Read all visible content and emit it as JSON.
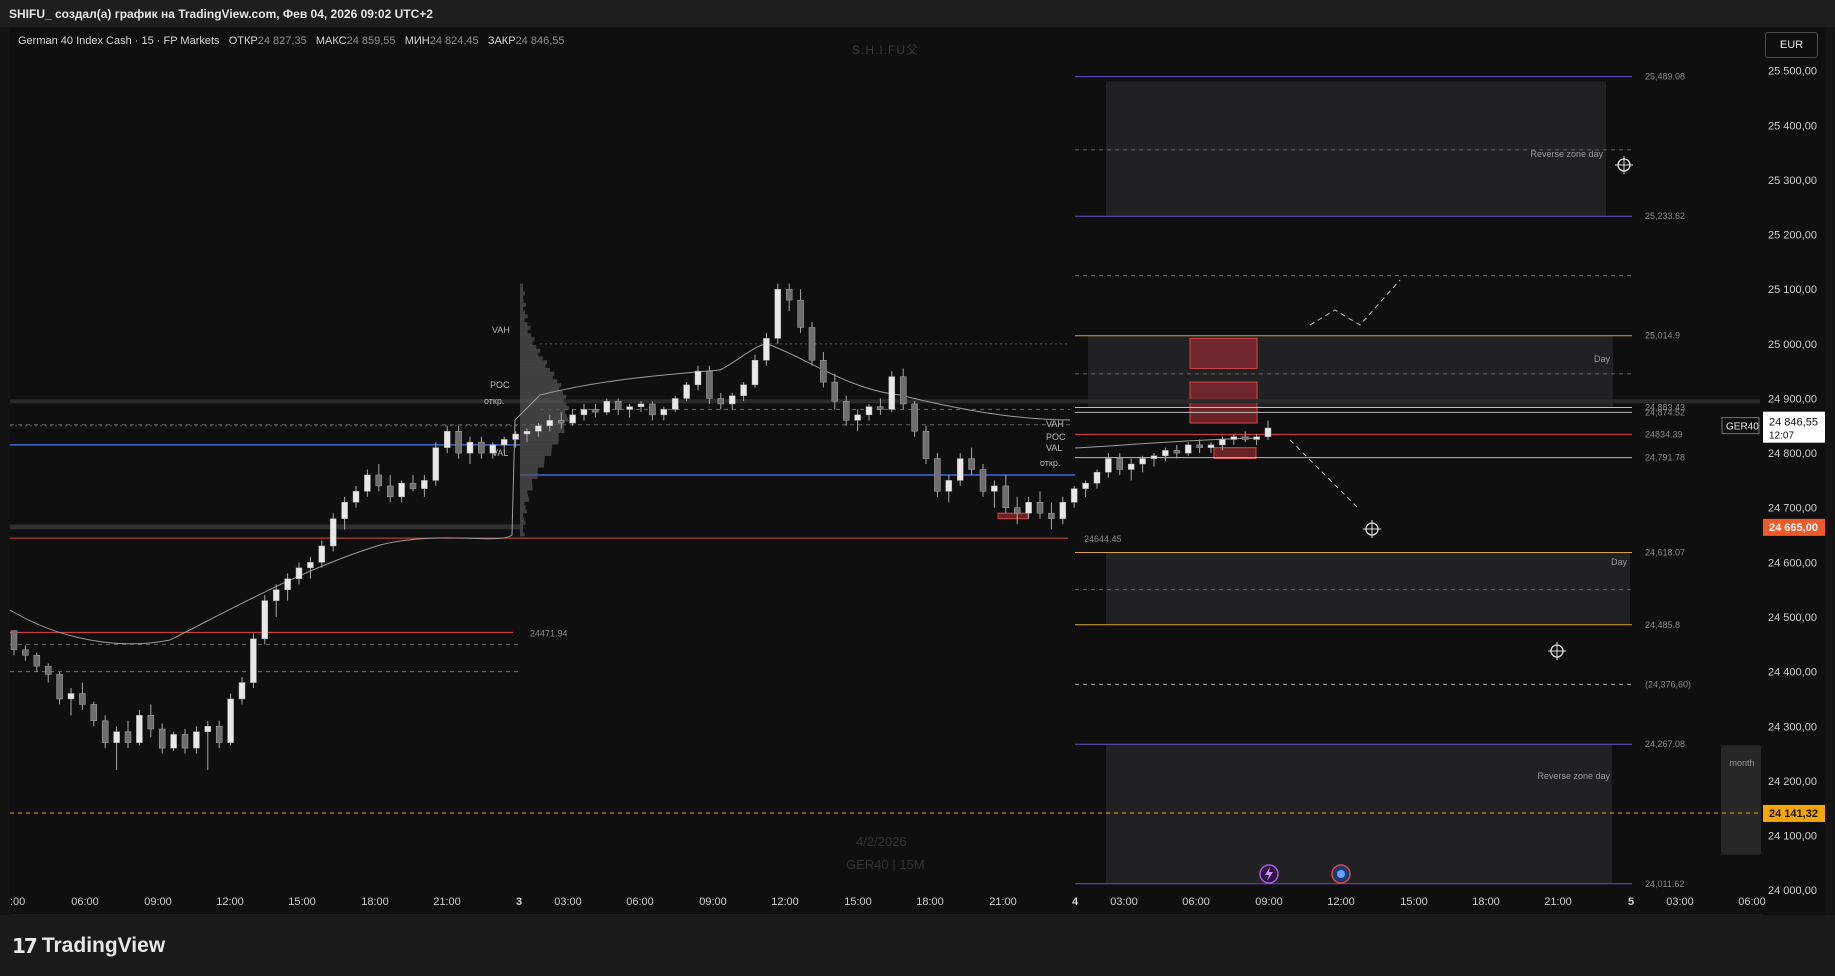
{
  "window": {
    "title": "SHIFU_ создал(а) график на TradingView.com, Фев 04, 2026 09:02 UTC+2"
  },
  "legend": {
    "symbol": "German 40 Index Cash · 15 · FP Markets",
    "open_label": "ОТКР",
    "open_value": "24 827,35",
    "high_label": "МАКС",
    "high_value": "24 859,55",
    "low_label": "МИН",
    "low_value": "24 824,45",
    "close_label": "ЗАКР",
    "close_value": "24 846,55"
  },
  "watermark": "S.H.I.FU父",
  "background_date": "4/2/2026",
  "background_symbol": "GER40 | 15M",
  "currency": "EUR",
  "brand": {
    "name": "TradingView"
  },
  "chart_data": {
    "type": "candlestick",
    "symbol": "GER40",
    "timeframe": "15",
    "y_axis": {
      "side": "right",
      "ylim": [
        23960,
        25580
      ],
      "ticks": [
        "25 500,00",
        "25 400,00",
        "25 300,00",
        "25 200,00",
        "25 100,00",
        "25 000,00",
        "24 900,00",
        "24 800,00",
        "24 700,00",
        "24 600,00",
        "24 500,00",
        "24 400,00",
        "24 300,00",
        "24 200,00",
        "24 100,00",
        "24 000,00"
      ],
      "tick_values": [
        25500,
        25400,
        25300,
        25200,
        25100,
        25000,
        24900,
        24800,
        24700,
        24600,
        24500,
        24400,
        24300,
        24200,
        24100,
        24000
      ]
    },
    "x_axis": {
      "ticks": [
        ":00",
        "06:00",
        "09:00",
        "12:00",
        "15:00",
        "18:00",
        "21:00",
        "3",
        "03:00",
        "06:00",
        "09:00",
        "12:00",
        "15:00",
        "18:00",
        "21:00",
        "4",
        "03:00",
        "06:00",
        "09:00",
        "12:00",
        "15:00",
        "18:00",
        "21:00",
        "5",
        "03:00",
        "06:00"
      ]
    },
    "price_labels": [
      {
        "symbol": "GER40",
        "price": "24 846,55",
        "countdown": "12:07",
        "value": 24846.55,
        "color": "#ffffff"
      },
      {
        "price": "24 665,00",
        "value": 24665,
        "color": "#f05a28"
      },
      {
        "price": "24 141,32",
        "value": 24141.32,
        "color": "#f7a600"
      }
    ],
    "levels": [
      {
        "label": "25,489.08",
        "value": 25489.08,
        "color": "#6a4fd0"
      },
      {
        "label": "25,233.62",
        "value": 25233.62,
        "color": "#6a4fd0"
      },
      {
        "label": "25,014.9",
        "value": 25014.9,
        "color": "#d9a43a"
      },
      {
        "label": "24,883.43",
        "value": 24883.43,
        "color": "#bdbdbd"
      },
      {
        "label": "24,874.52",
        "value": 24874.52,
        "color": "#bdbdbd"
      },
      {
        "label": "24834.39",
        "value": 24834.39,
        "color": "#e04545"
      },
      {
        "label": "24,791.78",
        "value": 24791.78,
        "color": "#bdbdbd"
      },
      {
        "label": "24644.45",
        "value": 24644.45,
        "color": "#e04545"
      },
      {
        "label": "24,618.07",
        "value": 24618.07,
        "color": "#d9a43a"
      },
      {
        "label": "24,485.8",
        "value": 24485.8,
        "color": "#d9a43a"
      },
      {
        "label": "24471.94",
        "value": 24471.94,
        "color": "#e04545"
      },
      {
        "label": "(24,376,60)",
        "value": 24376.6,
        "color": "#9a9a9a"
      },
      {
        "label": "24,267.08",
        "value": 24267.08,
        "color": "#6a4fd0"
      },
      {
        "label": "24,011.62",
        "value": 24011.62,
        "color": "#6a4fd0"
      }
    ],
    "zones": [
      {
        "label": "Reverse zone day",
        "top": 25480,
        "bottom": 25233.62
      },
      {
        "label": "Day",
        "top": 25014.9,
        "bottom": 24883.43
      },
      {
        "label": "Day",
        "top": 24618.07,
        "bottom": 24485.8
      },
      {
        "label": "Reverse zone day",
        "top": 24267.08,
        "bottom": 24011.62
      },
      {
        "label": "month",
        "top": 24265,
        "bottom": 24065
      }
    ],
    "profile_labels": {
      "vah": "VAH",
      "poc": "POC",
      "val": "VAL",
      "open": "откр."
    },
    "candles": [
      [
        24475,
        24475,
        24430,
        24440
      ],
      [
        24440,
        24448,
        24420,
        24430
      ],
      [
        24430,
        24435,
        24400,
        24410
      ],
      [
        24410,
        24415,
        24380,
        24395
      ],
      [
        24395,
        24400,
        24340,
        24350
      ],
      [
        24350,
        24370,
        24320,
        24360
      ],
      [
        24360,
        24380,
        24330,
        24340
      ],
      [
        24340,
        24345,
        24300,
        24310
      ],
      [
        24310,
        24320,
        24260,
        24270
      ],
      [
        24270,
        24300,
        24220,
        24290
      ],
      [
        24290,
        24310,
        24260,
        24270
      ],
      [
        24270,
        24330,
        24265,
        24320
      ],
      [
        24320,
        24340,
        24280,
        24295
      ],
      [
        24295,
        24305,
        24250,
        24260
      ],
      [
        24260,
        24290,
        24255,
        24285
      ],
      [
        24285,
        24295,
        24250,
        24260
      ],
      [
        24260,
        24300,
        24250,
        24290
      ],
      [
        24290,
        24310,
        24220,
        24300
      ],
      [
        24300,
        24310,
        24260,
        24270
      ],
      [
        24270,
        24360,
        24265,
        24350
      ],
      [
        24350,
        24390,
        24340,
        24380
      ],
      [
        24380,
        24470,
        24370,
        24460
      ],
      [
        24460,
        24540,
        24450,
        24530
      ],
      [
        24530,
        24560,
        24500,
        24550
      ],
      [
        24550,
        24580,
        24530,
        24570
      ],
      [
        24570,
        24600,
        24560,
        24590
      ],
      [
        24590,
        24610,
        24570,
        24600
      ],
      [
        24600,
        24640,
        24590,
        24630
      ],
      [
        24630,
        24690,
        24620,
        24680
      ],
      [
        24680,
        24720,
        24660,
        24710
      ],
      [
        24710,
        24740,
        24700,
        24730
      ],
      [
        24730,
        24770,
        24720,
        24760
      ],
      [
        24760,
        24780,
        24730,
        24740
      ],
      [
        24740,
        24760,
        24710,
        24720
      ],
      [
        24720,
        24750,
        24710,
        24745
      ],
      [
        24745,
        24760,
        24730,
        24735
      ],
      [
        24735,
        24760,
        24720,
        24750
      ],
      [
        24750,
        24820,
        24740,
        24810
      ],
      [
        24810,
        24850,
        24800,
        24840
      ],
      [
        24840,
        24850,
        24790,
        24800
      ],
      [
        24800,
        24830,
        24780,
        24820
      ],
      [
        24820,
        24830,
        24790,
        24800
      ],
      [
        24800,
        24820,
        24790,
        24815
      ],
      [
        24815,
        24830,
        24800,
        24825
      ],
      [
        24825,
        24840,
        24810,
        24835
      ],
      [
        24835,
        24845,
        24820,
        24840
      ],
      [
        24840,
        24855,
        24830,
        24850
      ],
      [
        24850,
        24870,
        24840,
        24860
      ],
      [
        24860,
        24875,
        24845,
        24855
      ],
      [
        24855,
        24880,
        24850,
        24870
      ],
      [
        24870,
        24890,
        24860,
        24880
      ],
      [
        24880,
        24890,
        24865,
        24875
      ],
      [
        24875,
        24900,
        24870,
        24895
      ],
      [
        24895,
        24900,
        24870,
        24880
      ],
      [
        24880,
        24890,
        24865,
        24885
      ],
      [
        24885,
        24895,
        24875,
        24890
      ],
      [
        24890,
        24895,
        24860,
        24870
      ],
      [
        24870,
        24885,
        24860,
        24880
      ],
      [
        24880,
        24905,
        24875,
        24900
      ],
      [
        24900,
        24930,
        24895,
        24925
      ],
      [
        24925,
        24960,
        24915,
        24950
      ],
      [
        24950,
        24960,
        24890,
        24900
      ],
      [
        24900,
        24910,
        24880,
        24890
      ],
      [
        24890,
        24910,
        24880,
        24905
      ],
      [
        24905,
        24930,
        24895,
        24925
      ],
      [
        24925,
        24980,
        24920,
        24970
      ],
      [
        24970,
        25020,
        24960,
        25010
      ],
      [
        25010,
        25110,
        25000,
        25100
      ],
      [
        25100,
        25110,
        25060,
        25080
      ],
      [
        25080,
        25100,
        25020,
        25030
      ],
      [
        25030,
        25040,
        24960,
        24970
      ],
      [
        24970,
        24985,
        24920,
        24930
      ],
      [
        24930,
        24945,
        24880,
        24895
      ],
      [
        24895,
        24905,
        24850,
        24860
      ],
      [
        24860,
        24880,
        24840,
        24870
      ],
      [
        24870,
        24890,
        24860,
        24885
      ],
      [
        24885,
        24900,
        24870,
        24880
      ],
      [
        24880,
        24950,
        24875,
        24940
      ],
      [
        24940,
        24955,
        24880,
        24890
      ],
      [
        24890,
        24895,
        24830,
        24840
      ],
      [
        24840,
        24850,
        24780,
        24790
      ],
      [
        24790,
        24800,
        24720,
        24730
      ],
      [
        24730,
        24760,
        24710,
        24750
      ],
      [
        24750,
        24800,
        24740,
        24790
      ],
      [
        24790,
        24810,
        24760,
        24770
      ],
      [
        24770,
        24780,
        24720,
        24730
      ],
      [
        24730,
        24750,
        24700,
        24740
      ],
      [
        24740,
        24760,
        24690,
        24700
      ],
      [
        24700,
        24720,
        24670,
        24690
      ],
      [
        24690,
        24720,
        24680,
        24710
      ],
      [
        24710,
        24730,
        24680,
        24690
      ],
      [
        24690,
        24710,
        24660,
        24680
      ],
      [
        24680,
        24720,
        24670,
        24710
      ],
      [
        24710,
        24740,
        24700,
        24735
      ],
      [
        24735,
        24750,
        24720,
        24745
      ],
      [
        24745,
        24770,
        24735,
        24765
      ],
      [
        24765,
        24800,
        24755,
        24790
      ],
      [
        24790,
        24800,
        24760,
        24770
      ],
      [
        24770,
        24790,
        24750,
        24780
      ],
      [
        24780,
        24795,
        24765,
        24790
      ],
      [
        24790,
        24800,
        24775,
        24795
      ],
      [
        24795,
        24810,
        24785,
        24805
      ],
      [
        24805,
        24815,
        24790,
        24800
      ],
      [
        24800,
        24820,
        24795,
        24815
      ],
      [
        24815,
        24825,
        24800,
        24810
      ],
      [
        24810,
        24820,
        24800,
        24815
      ],
      [
        24815,
        24830,
        24805,
        24825
      ],
      [
        24825,
        24835,
        24815,
        24830
      ],
      [
        24830,
        24840,
        24820,
        24825
      ],
      [
        24825,
        24835,
        24815,
        24830
      ],
      [
        24830,
        24860,
        24824,
        24846
      ]
    ]
  }
}
